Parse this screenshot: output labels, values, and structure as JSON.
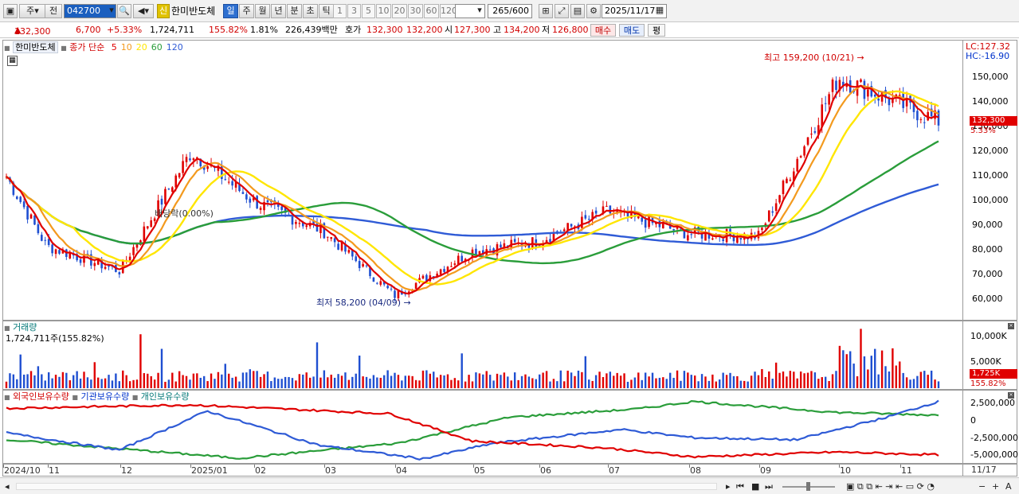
{
  "toolbar": {
    "view_toggle": "주",
    "prev_label": "전",
    "code_value": "042700",
    "new_badge": "신",
    "stock_name": "한미반도체",
    "periods": [
      "일",
      "주",
      "월",
      "년",
      "분",
      "초",
      "틱"
    ],
    "active_period": "일",
    "intervals": [
      "1",
      "3",
      "5",
      "10",
      "20",
      "30",
      "60",
      "120"
    ],
    "count_value": "265",
    "count_total": "/600",
    "date_value": "2025/11/17"
  },
  "quote": {
    "price": "132,300",
    "change": "6,700",
    "change_pct": "+5.33%",
    "volume": "1,724,711",
    "volume_ratio": "155.82%",
    "turnover": "1.81%",
    "amount": "226,439백만",
    "ask_label": "호가",
    "ask": "132,300",
    "bid": "132,200",
    "open_label": "시",
    "open": "127,300",
    "high_label": "고",
    "high": "134,200",
    "low_label": "저",
    "low": "126,800",
    "buy_label": "매수",
    "sell_label": "매도",
    "eval_label": "평"
  },
  "price_panel": {
    "name": "한미반도체",
    "indicator": "종가 단순",
    "ma_labels": [
      "5",
      "10",
      "20",
      "60",
      "120"
    ],
    "ma_colors": [
      "#e00000",
      "#f39a1e",
      "#ffe600",
      "#2a9d3a",
      "#2f5bd6"
    ],
    "lc": "LC:127.32",
    "hc": "HC:-16.90",
    "high_note": "최고 159,200 (10/21)",
    "low_note": "최저 58,200 (04/09)",
    "dividend_note": "배당락(0.00%)",
    "last_price_tag": "132,300",
    "last_pct_tag": "5.33%",
    "y_ticks": [
      "150,000",
      "140,000",
      "130,000",
      "120,000",
      "110,000",
      "100,000",
      "90,000",
      "80,000",
      "70,000",
      "60,000"
    ]
  },
  "volume_panel": {
    "title": "거래량",
    "value": "1,724,711주(155.82%)",
    "y_ticks": [
      "10,000K",
      "5,000K"
    ],
    "last_tag": "1,725K",
    "last_ratio": "155.82%"
  },
  "holdings_panel": {
    "legend": [
      "외국인보유수량",
      "기관보유수량",
      "개인보유수량"
    ],
    "colors": [
      "#e00000",
      "#2f5bd6",
      "#2a9d3a"
    ],
    "y_ticks": [
      "2,500,000",
      "0",
      "-2,500,000",
      "-5,000,000"
    ]
  },
  "x_axis": {
    "labels": [
      "2024/10",
      "11",
      "12",
      "2025/01",
      "02",
      "03",
      "04",
      "05",
      "06",
      "07",
      "08",
      "09",
      "10",
      "11"
    ],
    "right_label": "11/17"
  },
  "chart_data": {
    "type": "candlestick",
    "title": "한미반도체",
    "x_range": [
      "2024/10",
      "2025/11/17"
    ],
    "price_ylim": [
      55000,
      160000
    ],
    "price_path": [
      {
        "date": "2024/10",
        "close": 110000
      },
      {
        "date": "11",
        "close": 82000
      },
      {
        "date": "12",
        "close": 72000
      },
      {
        "date": "2025/01",
        "close": 120000
      },
      {
        "date": "02",
        "close": 100000
      },
      {
        "date": "03",
        "close": 88000
      },
      {
        "date": "04",
        "close": 62000
      },
      {
        "date": "05",
        "close": 80000
      },
      {
        "date": "06",
        "close": 84000
      },
      {
        "date": "07",
        "close": 96000
      },
      {
        "date": "08",
        "close": 87000
      },
      {
        "date": "09",
        "close": 86000
      },
      {
        "date": "10",
        "close": 150000
      },
      {
        "date": "11/17",
        "close": 132300
      }
    ],
    "high": {
      "value": 159200,
      "date": "10/21"
    },
    "low": {
      "value": 58200,
      "date": "04/09"
    },
    "last_close": 132300,
    "volume_ylim": [
      0,
      12000
    ],
    "volume_unit": "K"
  }
}
